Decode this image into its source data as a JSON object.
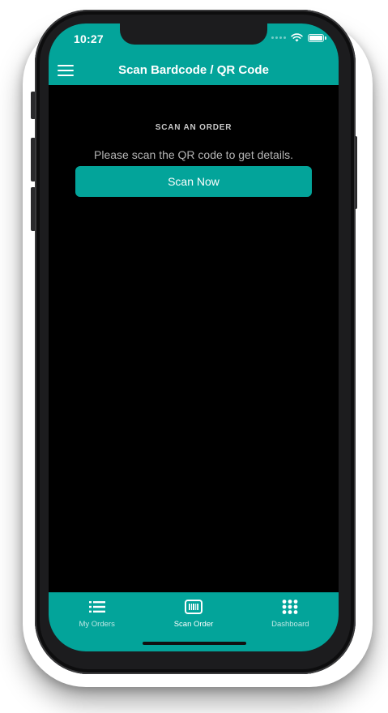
{
  "theme": {
    "accent": "#03a49a",
    "background": "#000000",
    "text_on_accent": "#ffffff"
  },
  "status_bar": {
    "time": "10:27",
    "icons": [
      "cellular-signal-icon",
      "wifi-icon",
      "battery-icon"
    ]
  },
  "header": {
    "menu_icon": "hamburger-menu-icon",
    "title": "Scan Bardcode / QR Code"
  },
  "main": {
    "section_heading": "SCAN AN ORDER",
    "instruction": "Please scan the QR code to get details.",
    "scan_button_label": "Scan Now"
  },
  "tab_bar": {
    "tabs": [
      {
        "label": "My Orders",
        "icon": "list-icon",
        "active": false
      },
      {
        "label": "Scan Order",
        "icon": "barcode-scanner-icon",
        "active": true
      },
      {
        "label": "Dashboard",
        "icon": "grid-dots-icon",
        "active": false
      }
    ]
  }
}
